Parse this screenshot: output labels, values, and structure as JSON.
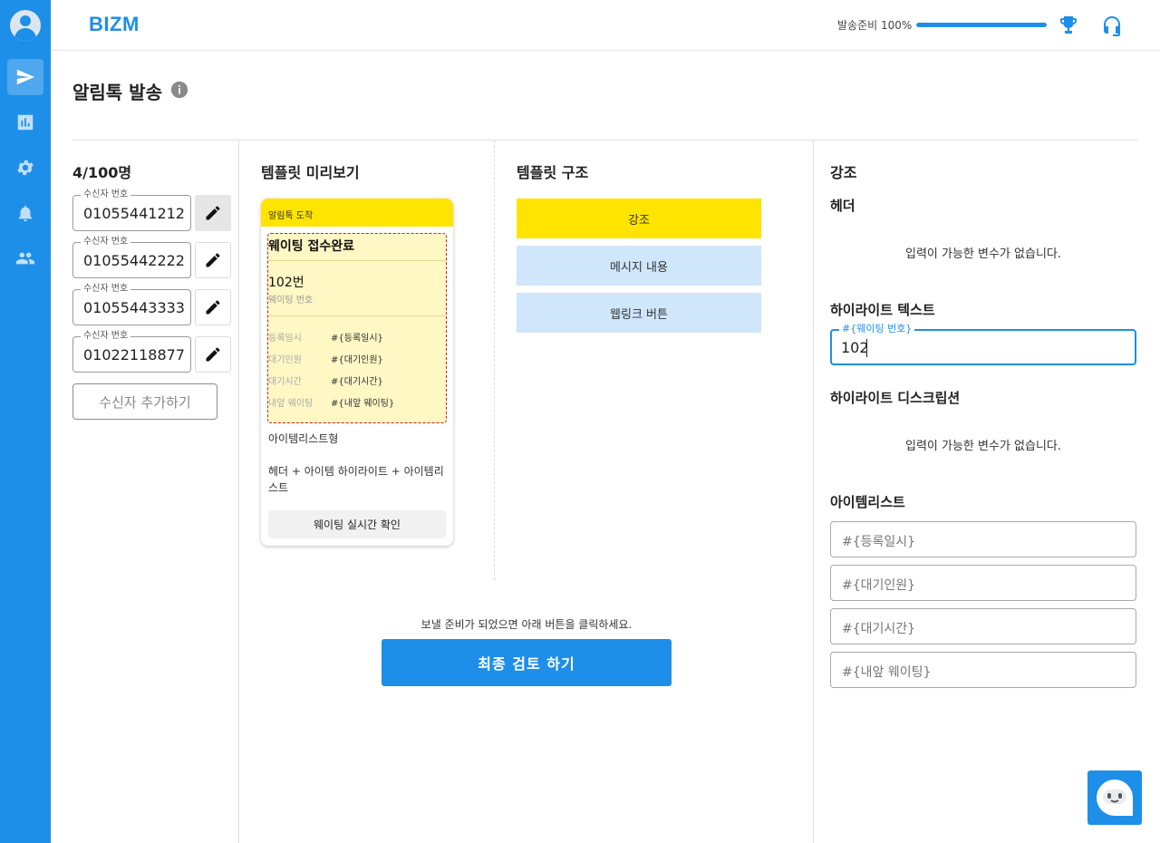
{
  "header": {
    "logo": "BIZM",
    "ready_label": "발송준비 100%",
    "ready_progress": 1.0
  },
  "nav": {
    "items": [
      "send-icon",
      "chart-icon",
      "gear-icon",
      "bell-icon",
      "people-icon"
    ],
    "active": "send-icon"
  },
  "page": {
    "title": "알림톡 발송"
  },
  "recipients": {
    "count": "4/100명",
    "field_label": "수신자 번호",
    "items": [
      {
        "label": "수신자 번호",
        "value": "01055441212"
      },
      {
        "label": "수신자 번호",
        "value": "01055442222"
      },
      {
        "label": "수신자 번호",
        "value": "01055443333"
      },
      {
        "label": "수신자 번호",
        "value": "01022118877"
      }
    ],
    "add_button": "수신자 추가하기"
  },
  "preview": {
    "title": "템플릿 미리보기",
    "card_header": "알림톡 도착",
    "highlight_title": "웨이팅 접수완료",
    "highlight_number": "102번",
    "highlight_desc": "웨이팅 번호",
    "items": [
      {
        "key": "등록일시",
        "value": "#{등록일시}"
      },
      {
        "key": "대기인원",
        "value": "#{대기인원}"
      },
      {
        "key": "대기시간",
        "value": "#{대기시간}"
      },
      {
        "key": "내앞 웨이팅",
        "value": "#{내앞 웨이팅}"
      }
    ],
    "type_label": "아이템리스트형",
    "structure_text": "헤더 + 아이템 하이라이트 + 아이템리스트",
    "weblink_button": "웨이팅 실시간 확인"
  },
  "structure": {
    "title": "템플릿 구조",
    "blocks": [
      "강조",
      "메시지 내용",
      "웹링크 버튼"
    ]
  },
  "action": {
    "ready_message": "보낼 준비가 되었으면 아래 버튼을 클릭하세요.",
    "review_button": "최종 검토 하기"
  },
  "emphasis": {
    "title": "강조",
    "header_label": "헤더",
    "header_empty": "입력이 가능한 변수가 없습니다.",
    "highlight_text_label": "하이라이트 텍스트",
    "highlight_input_label": "#{웨이팅 번호}",
    "highlight_input_value": "102",
    "highlight_desc_label": "하이라이트 디스크립션",
    "highlight_desc_empty": "입력이 가능한 변수가 없습니다.",
    "itemlist_label": "아이템리스트",
    "itemlist_placeholders": [
      "#{등록일시}",
      "#{대기인원}",
      "#{대기시간}",
      "#{내앞 웨이팅}"
    ]
  },
  "colors": {
    "brand": "#1e8fe8",
    "kakao_yellow": "#ffe400",
    "light_blue": "#cfe6fb"
  }
}
